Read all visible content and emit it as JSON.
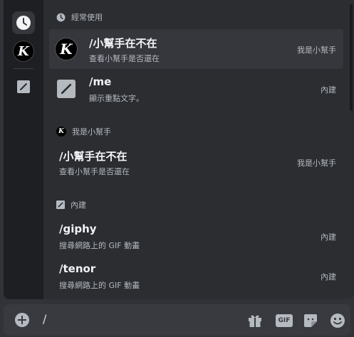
{
  "sections": {
    "frequent": "經常使用",
    "bot": "我是小幫手",
    "builtin": "內建"
  },
  "rail": {
    "frequent_icon": "clock-icon",
    "bot_icon": "k-logo",
    "builtin_icon": "slash-square-icon"
  },
  "commands": {
    "frequent": [
      {
        "name": "/小幫手在不在",
        "desc": "查看小幫手是否還在",
        "source": "我是小幫手",
        "icon": "k-avatar"
      },
      {
        "name": "/me",
        "desc": "顯示重點文字。",
        "source": "內建",
        "icon": "slash-square-icon"
      }
    ],
    "bot": [
      {
        "name": "/小幫手在不在",
        "desc": "查看小幫手是否還在",
        "source": "我是小幫手"
      }
    ],
    "builtin": [
      {
        "name": "/giphy",
        "desc": "搜尋網路上的 GIF 動畫",
        "source": "內建"
      },
      {
        "name": "/tenor",
        "desc": "搜尋網路上的 GIF 動畫",
        "source": "內建"
      }
    ]
  },
  "composer": {
    "value": "/",
    "gift_icon": "gift-icon",
    "gif_label": "GIF",
    "sticker_icon": "sticker-icon",
    "emoji_icon": "emoji-icon"
  },
  "k_letter": "K"
}
